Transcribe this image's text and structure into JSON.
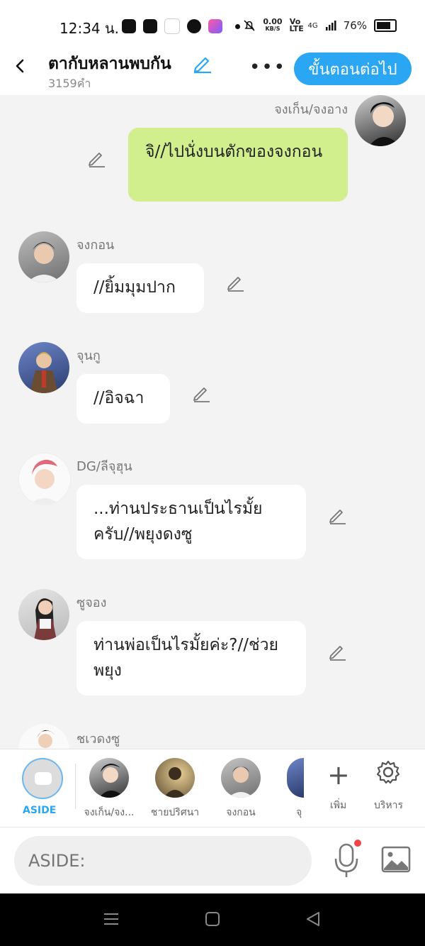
{
  "status": {
    "time": "12:34 น.",
    "speed": "0.00",
    "speed_unit": "KB/S",
    "volte": "Vo LTE",
    "network": "4G",
    "battery": "76%"
  },
  "header": {
    "title": "ตากับหลานพบกัน",
    "word_count": "3159คำ",
    "more": "•••",
    "next_button": "ขั้นตอนต่อไป"
  },
  "messages": [
    {
      "sender": "จงเก็น/จงอาง",
      "text": "จิ//ไปนั่งบนตักของจงกอน",
      "side": "right"
    },
    {
      "sender": "จงกอน",
      "text": "//ยิ้มมุมปาก",
      "side": "left"
    },
    {
      "sender": "จุนกู",
      "text": "//อิจฉา",
      "side": "left"
    },
    {
      "sender": "DG/ลีจุฮุน",
      "text": "...ท่านประธานเป็นไรมั้ยครับ//พยุงดงซู",
      "side": "left"
    },
    {
      "sender": "ซูจอง",
      "text": "ท่านพ่อเป็นไรมั้ยค่ะ?//ช่วยพยุง",
      "side": "left"
    },
    {
      "sender": "ชเวดงซู",
      "text": "",
      "side": "left"
    }
  ],
  "character_bar": {
    "aside": "ASIDE",
    "characters": [
      "จงเก็น/จง...",
      "ชายปริศนา",
      "จงกอน",
      "จุ"
    ],
    "add": "เพิ่ม",
    "manage": "บริหาร"
  },
  "input": {
    "placeholder": "ASIDE:"
  },
  "colors": {
    "accent": "#2aa6f2",
    "right_bubble": "#d2ef8e",
    "background": "#f3f3f3"
  }
}
